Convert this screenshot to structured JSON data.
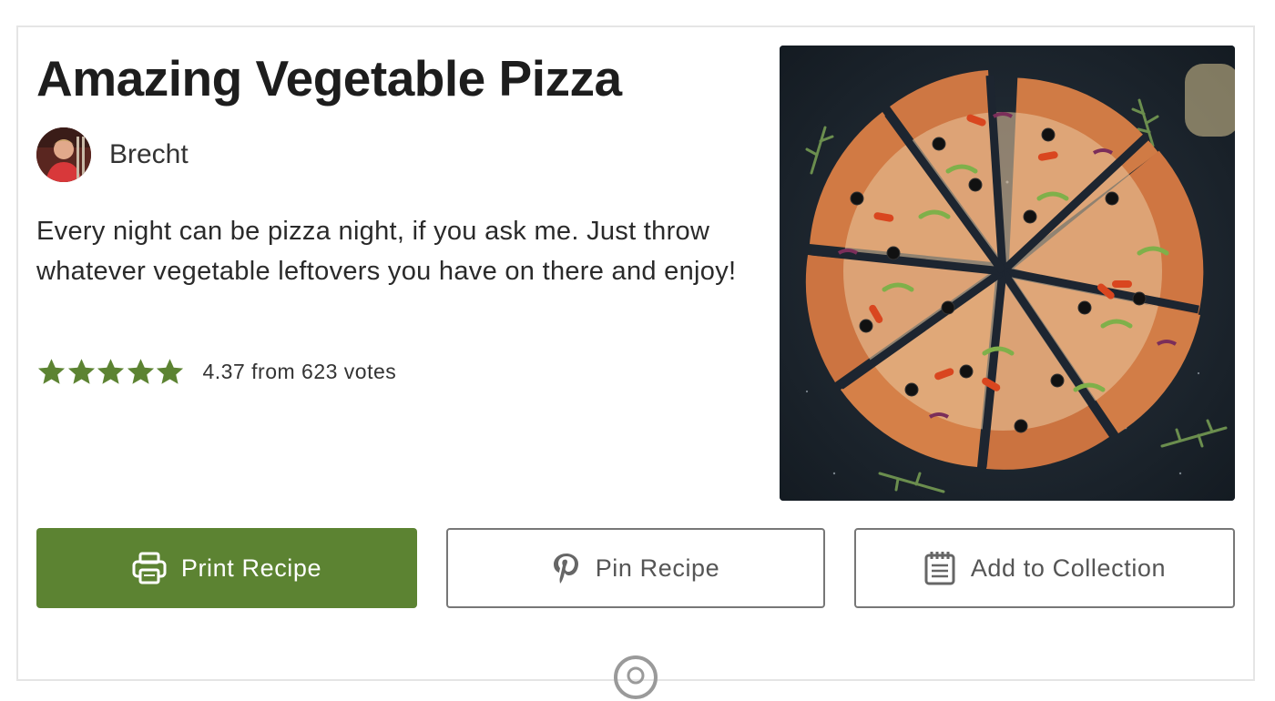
{
  "recipe": {
    "title": "Amazing Vegetable Pizza",
    "author": "Brecht",
    "summary": "Every night can be pizza night, if you ask me. Just throw whatever vegetable leftovers you have on there and enjoy!",
    "rating": {
      "average": 4.37,
      "votes": 623,
      "stars_filled": 5,
      "stars_total": 5,
      "text": "4.37 from 623 votes"
    }
  },
  "buttons": {
    "print": {
      "label": "Print Recipe",
      "icon": "printer-icon"
    },
    "pin": {
      "label": "Pin Recipe",
      "icon": "pinterest-icon"
    },
    "collection": {
      "label": "Add to Collection",
      "icon": "notepad-icon"
    }
  },
  "colors": {
    "accent": "#5c8332",
    "star": "#5c8332",
    "border": "#777777"
  }
}
